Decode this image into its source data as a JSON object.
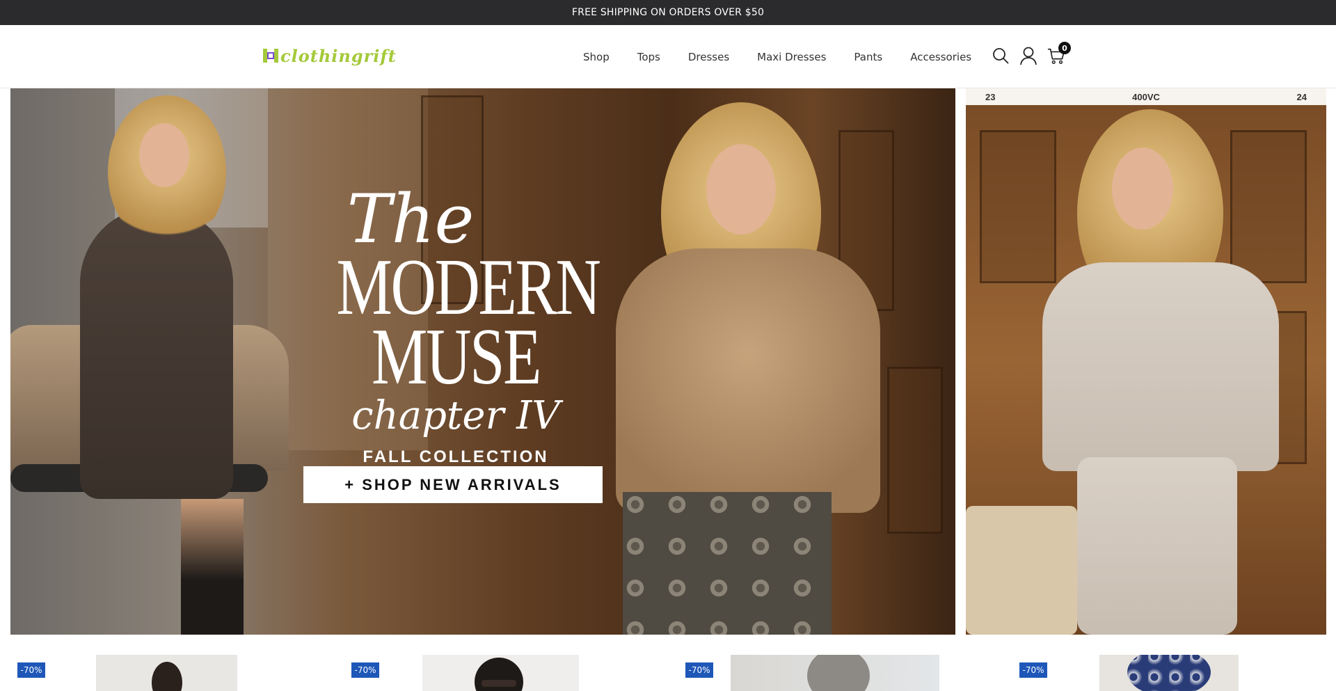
{
  "announcement": "FREE SHIPPING ON ORDERS OVER $50",
  "header": {
    "logo_text": "clothingrift",
    "nav": [
      "Shop",
      "Tops",
      "Dresses",
      "Maxi Dresses",
      "Pants",
      "Accessories"
    ],
    "cart_count": "0",
    "icons": [
      "search-icon",
      "user-icon",
      "cart-icon"
    ]
  },
  "hero": {
    "line_the": "The",
    "line_modern": "MODERN",
    "line_muse": "MUSE",
    "line_chapter": "chapter IV",
    "subtitle": "FALL COLLECTION",
    "cta": "+ SHOP NEW ARRIVALS"
  },
  "side_banner": {
    "left": "23",
    "center": "400VC",
    "right": "24"
  },
  "products": [
    {
      "badge": "-70%"
    },
    {
      "badge": "-70%"
    },
    {
      "badge": "-70%"
    },
    {
      "badge": "-70%"
    }
  ],
  "colors": {
    "announcement_bg": "#2b2b2d",
    "logo_green": "#a4c93a",
    "badge_blue": "#1e57b8"
  }
}
